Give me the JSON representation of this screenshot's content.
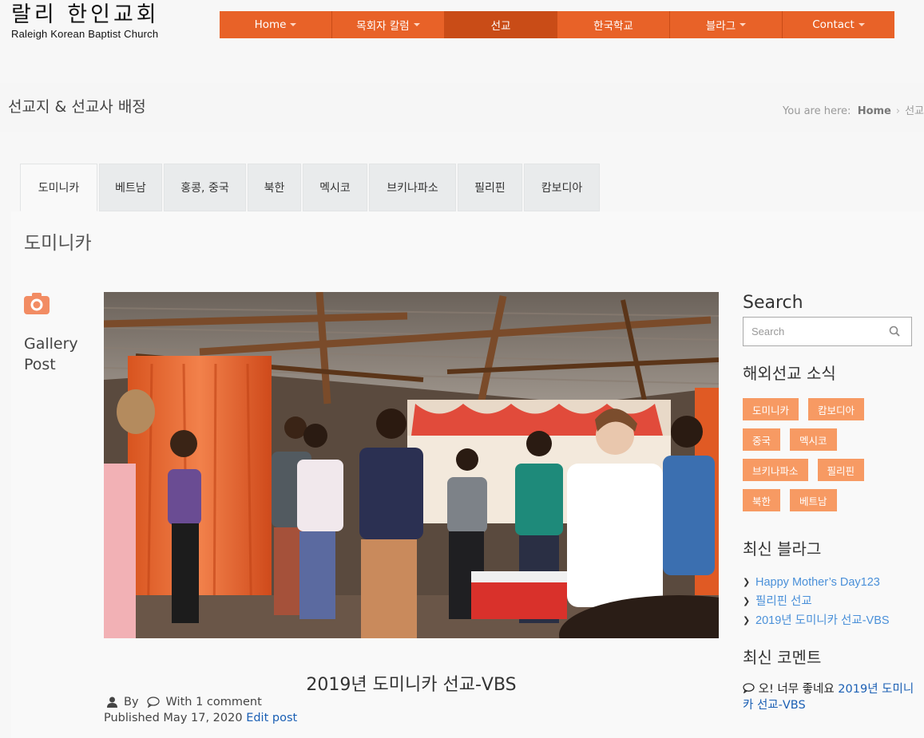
{
  "header": {
    "logo_ko": "랄리 한인교회",
    "logo_en": "Raleigh Korean Baptist Church"
  },
  "nav": [
    {
      "label": "Home",
      "dropdown": true
    },
    {
      "label": "목회자 칼럼",
      "dropdown": true
    },
    {
      "label": "선교",
      "dropdown": false,
      "active": true
    },
    {
      "label": "한국학교",
      "dropdown": false
    },
    {
      "label": "블라그",
      "dropdown": true
    },
    {
      "label": "Contact",
      "dropdown": true
    }
  ],
  "page": {
    "title": "선교지 & 선교사 배정",
    "breadcrumb_prefix": "You are here:",
    "breadcrumb_home": "Home",
    "breadcrumb_current": "선교"
  },
  "tabs": [
    "도미니카",
    "베트남",
    "홍콩, 중국",
    "북한",
    "멕시코",
    "브키나파소",
    "필리핀",
    "캄보디아"
  ],
  "panel": {
    "title": "도미니카"
  },
  "post": {
    "format_label_line1": "Gallery",
    "format_label_line2": "Post",
    "title": "2019년 도미니카 선교-VBS",
    "by_label": "By",
    "comments_label": "With 1 comment",
    "published_label": "Published May 17, 2020",
    "edit_label": "Edit post"
  },
  "sidebar": {
    "search_heading": "Search",
    "search_placeholder": "Search",
    "news_heading": "해외선교 소식",
    "tags": [
      "도미니카",
      "캄보디아",
      "중국",
      "멕시코",
      "브키나파소",
      "필리핀",
      "북한",
      "베트남"
    ],
    "recent_heading": "최신 블라그",
    "recent_posts": [
      "Happy Mother’s Day123",
      "필리핀 선교",
      "2019년 도미니카 선교-VBS"
    ],
    "comments_heading": "최신 코멘트",
    "comment_text": "오! 너무 좋네요",
    "comment_link": "2019년 도미니카 선교-VBS"
  },
  "colors": {
    "nav_bg": "#e86228",
    "nav_active": "#c94c17",
    "tag_bg": "#f79a63",
    "link": "#1a5fb4",
    "camera_icon": "#f28c63"
  }
}
